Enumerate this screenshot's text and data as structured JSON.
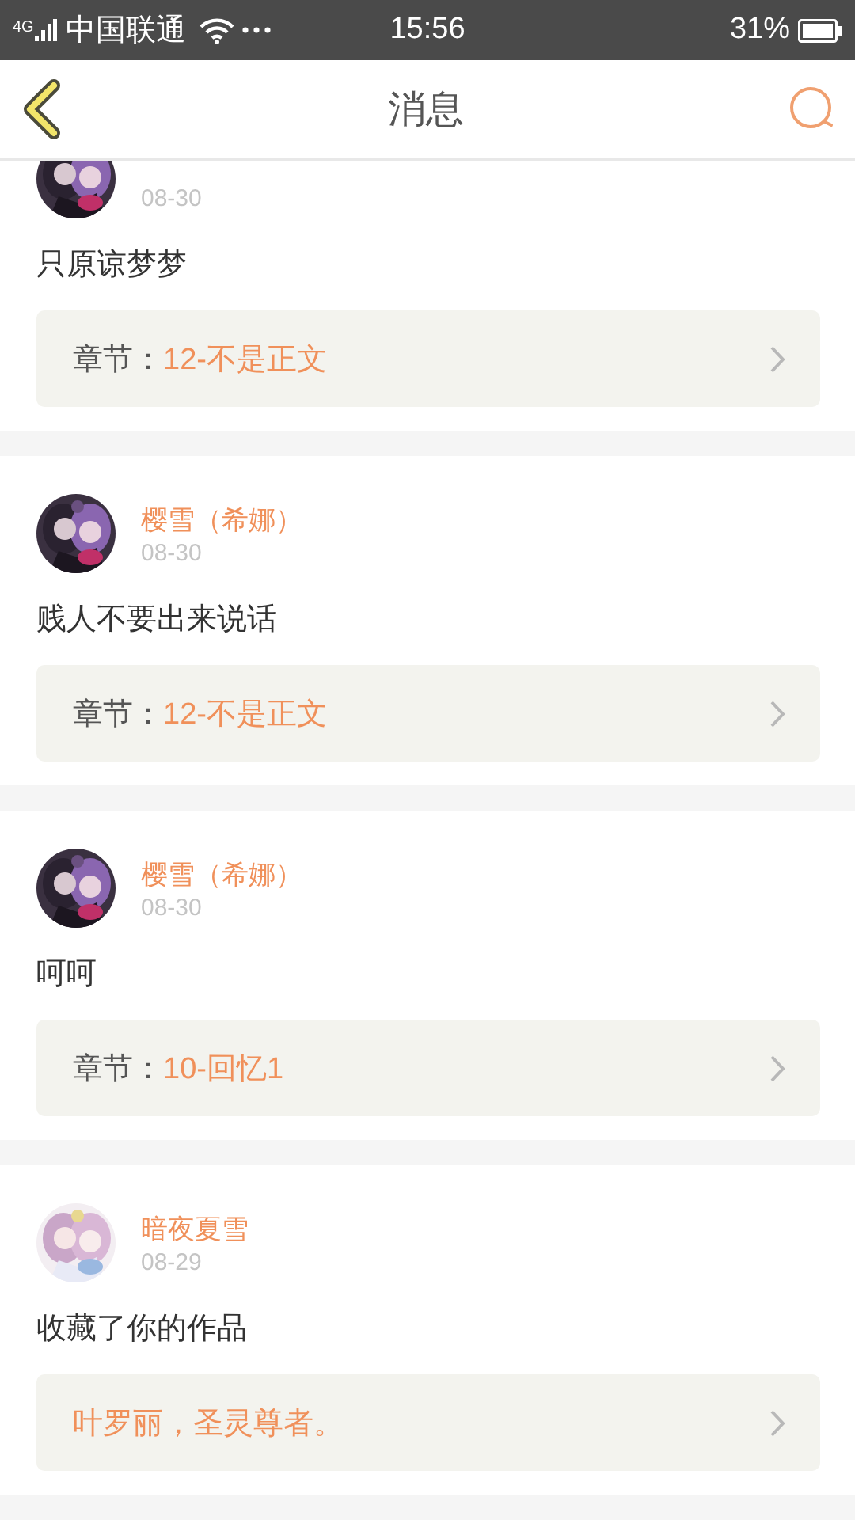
{
  "status_bar": {
    "network": "4G",
    "carrier": "中国联通",
    "time": "15:56",
    "battery": "31%"
  },
  "header": {
    "title": "消息"
  },
  "messages": [
    {
      "date": "08-30",
      "text": "只原谅梦梦",
      "link": {
        "label": "章节：",
        "title": "12-不是正文"
      }
    },
    {
      "name": "樱雪（希娜）",
      "date": "08-30",
      "text": "贱人不要出来说话",
      "link": {
        "label": "章节：",
        "title": "12-不是正文"
      }
    },
    {
      "name": "樱雪（希娜）",
      "date": "08-30",
      "text": "呵呵",
      "link": {
        "label": "章节：",
        "title": "10-回忆1"
      }
    },
    {
      "name": "暗夜夏雪",
      "date": "08-29",
      "text": "收藏了你的作品",
      "link": {
        "title": "叶罗丽，圣灵尊者。"
      }
    }
  ]
}
